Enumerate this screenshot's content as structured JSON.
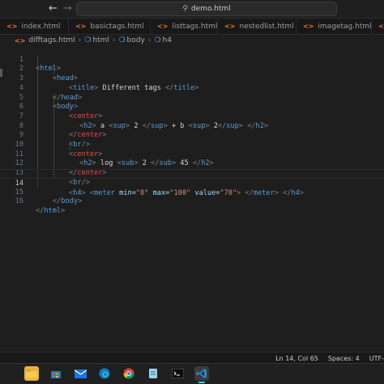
{
  "titlebar": {
    "back_icon": "arrow-left-icon",
    "forward_icon": "arrow-right-icon",
    "search_icon": "search-icon",
    "search_text": "demo.html"
  },
  "tabs": [
    {
      "label": "index.html"
    },
    {
      "label": "basictags.html"
    },
    {
      "label": "listtags.html"
    },
    {
      "label": "nestedlist.html"
    },
    {
      "label": "imagetag.html"
    },
    {
      "label": "an"
    }
  ],
  "breadcrumb": {
    "file": "difftags.html",
    "items": [
      "html",
      "body",
      "h4"
    ]
  },
  "editor": {
    "current_line": 14,
    "lines": [
      {
        "n": "1"
      },
      {
        "n": "2"
      },
      {
        "n": "3"
      },
      {
        "n": "4"
      },
      {
        "n": "5"
      },
      {
        "n": "6"
      },
      {
        "n": "7"
      },
      {
        "n": "8"
      },
      {
        "n": "9"
      },
      {
        "n": "10"
      },
      {
        "n": "11"
      },
      {
        "n": "12"
      },
      {
        "n": "13"
      },
      {
        "n": "14"
      },
      {
        "n": "15"
      },
      {
        "n": "16"
      }
    ],
    "tokens": {
      "l1": [
        "<",
        "html",
        ">"
      ],
      "l2": [
        "<",
        "head",
        ">"
      ],
      "l3": [
        "<",
        "title",
        ">",
        " Different tags ",
        "</",
        "title",
        ">"
      ],
      "l4": [
        "</",
        "head",
        ">"
      ],
      "l5": [
        "<",
        "body",
        ">"
      ],
      "l6": [
        "<",
        "center",
        ">"
      ],
      "l7": [
        "<",
        "h2",
        ">",
        " a ",
        "<",
        "sup",
        ">",
        " 2 ",
        "</",
        "sup",
        ">",
        " + b ",
        "<",
        "sup",
        ">",
        " 2",
        "</",
        "sup",
        ">",
        " ",
        "</",
        "h2",
        ">"
      ],
      "l8": [
        "</",
        "center",
        ">"
      ],
      "l9": [
        "<",
        "br",
        "/>"
      ],
      "l10": [
        "<",
        "center",
        ">"
      ],
      "l11": [
        "<",
        "h2",
        ">",
        " log ",
        "<",
        "sub",
        ">",
        " 2 ",
        "</",
        "sub",
        ">",
        " 45 ",
        "</",
        "h2",
        ">"
      ],
      "l12": [
        "</",
        "center",
        ">"
      ],
      "l13": [
        "<",
        "br",
        "/>"
      ],
      "l14": [
        "<",
        "h4",
        ">",
        " ",
        "<",
        "meter",
        " ",
        "min",
        "=",
        "\"0\"",
        " ",
        "max",
        "=",
        "\"100\"",
        " ",
        "value",
        "=",
        "\"70\"",
        ">",
        " ",
        "</",
        "meter",
        ">",
        " ",
        "</",
        "h4",
        ">"
      ],
      "l15": [
        "</",
        "body",
        ">"
      ],
      "l16": [
        "</",
        "html",
        ">"
      ]
    }
  },
  "statusbar": {
    "position": "Ln 14, Col 65",
    "spaces": "Spaces: 4",
    "encoding": "UTF-"
  },
  "taskbar": {
    "apps": [
      "file-explorer-icon",
      "store-icon",
      "mail-icon",
      "edge-icon",
      "chrome-icon",
      "notepad-icon",
      "terminal-icon",
      "vscode-icon"
    ]
  },
  "colors": {
    "background": "#1e1e1e",
    "tag": "#569cd6",
    "attribute": "#9cdcfe",
    "string": "#ce9178",
    "bracket": "#808080",
    "html_icon": "#e37933",
    "accent": "#4cc2ff"
  }
}
